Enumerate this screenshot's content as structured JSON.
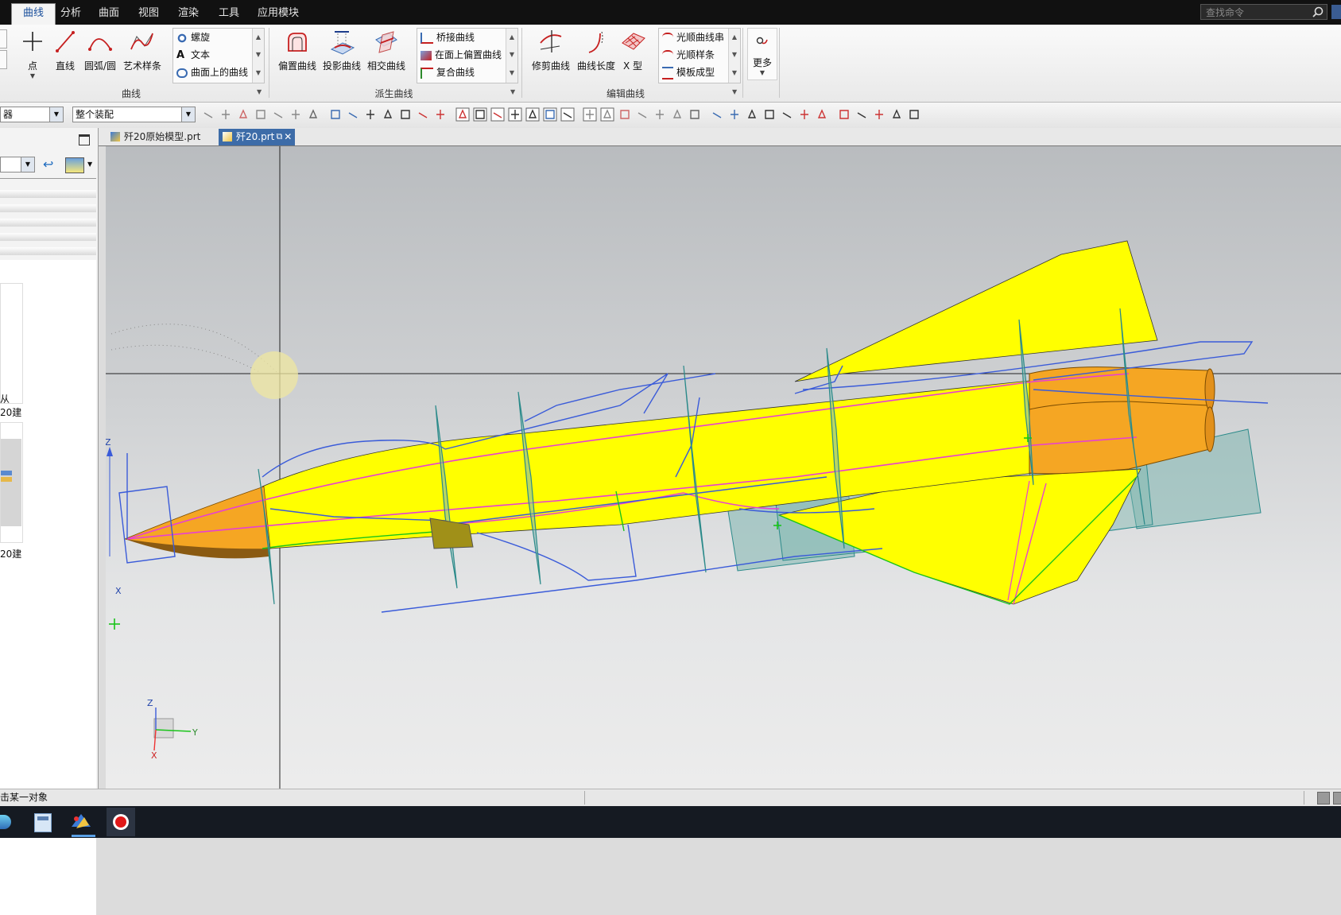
{
  "menu": {
    "tabs": [
      "曲线",
      "分析",
      "曲面",
      "视图",
      "渲染",
      "工具",
      "应用模块"
    ],
    "active_tab": "曲线",
    "search_placeholder": "查找命令"
  },
  "ribbon": {
    "curve_group": {
      "label": "曲线",
      "buttons": [
        "点",
        "直线",
        "圆弧/圆",
        "艺术样条"
      ],
      "gallery": [
        "螺旋",
        "文本",
        "曲面上的曲线"
      ]
    },
    "derived_group": {
      "label": "派生曲线",
      "buttons": [
        "偏置曲线",
        "投影曲线",
        "相交曲线"
      ],
      "gallery": [
        "桥接曲线",
        "在面上偏置曲线",
        "复合曲线"
      ]
    },
    "edit_group": {
      "label": "编辑曲线",
      "buttons": [
        "修剪曲线",
        "曲线长度",
        "X 型"
      ],
      "gallery": [
        "光顺曲线串",
        "光顺样条",
        "模板成型"
      ]
    },
    "more": {
      "label": "更多"
    }
  },
  "toolbar": {
    "selection_filter_partial": "器",
    "scope": "整个装配"
  },
  "doc_tabs": [
    {
      "label": "歼20原始模型.prt",
      "active": false
    },
    {
      "label": "歼20.prt",
      "active": true
    }
  ],
  "left_panel": {
    "partial_text_1": "从",
    "partial_text_2": "20建",
    "partial_text_3": "20建"
  },
  "viewport": {
    "axis_labels": {
      "z": "Z",
      "x": "X",
      "y": "Y"
    }
  },
  "status": {
    "prompt": "击某一对象"
  },
  "colors": {
    "ribbon_active_tab": "#1a4f9c",
    "model_body": "#ffff00",
    "nozzle": "#f5a623",
    "wireframe": "#3a5bd9",
    "section_planes": "#7fb7b0",
    "spine_curve": "#e83fd3"
  }
}
